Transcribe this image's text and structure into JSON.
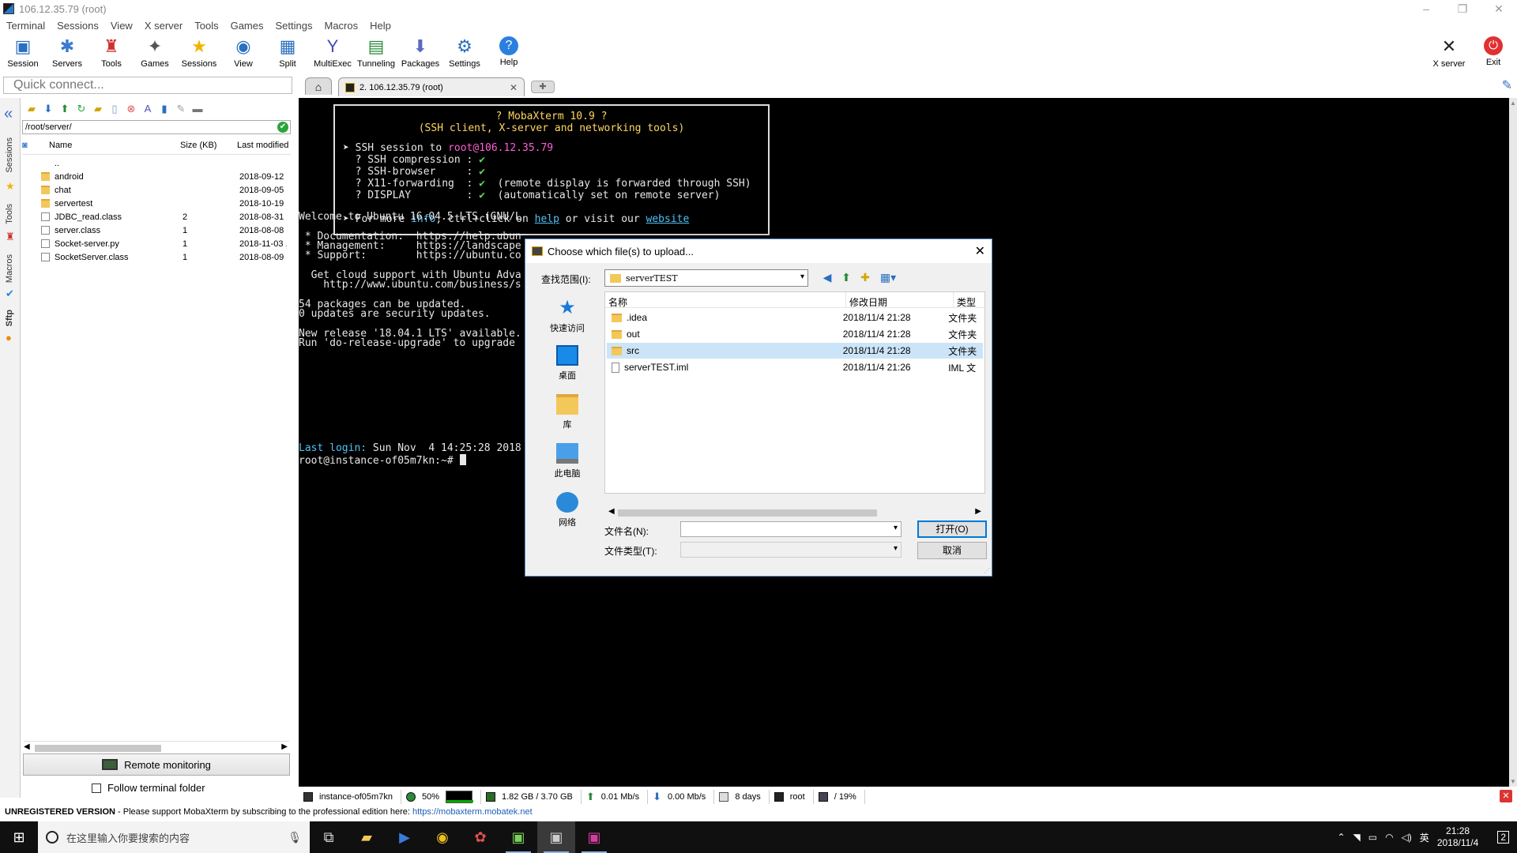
{
  "window": {
    "title": "106.12.35.79 (root)",
    "controls": [
      "–",
      "❐",
      "✕"
    ]
  },
  "menu": [
    "Terminal",
    "Sessions",
    "View",
    "X server",
    "Tools",
    "Games",
    "Settings",
    "Macros",
    "Help"
  ],
  "toolbar": {
    "session": "Session",
    "servers": "Servers",
    "tools": "Tools",
    "games": "Games",
    "sessions": "Sessions",
    "view": "View",
    "split": "Split",
    "multiexec": "MultiExec",
    "tunneling": "Tunneling",
    "packages": "Packages",
    "settings": "Settings",
    "help": "Help",
    "xserver": "X server",
    "exit": "Exit"
  },
  "quick_connect": {
    "placeholder": "Quick connect..."
  },
  "tabs": {
    "session_tab": "2. 106.12.35.79 (root)"
  },
  "vtabs": {
    "sessions": "Sessions",
    "tools": "Tools",
    "macros": "Macros",
    "sftp": "Sftp"
  },
  "sftp": {
    "path": "/root/server/",
    "columns": {
      "name": "Name",
      "size": "Size (KB)",
      "modified": "Last modified"
    },
    "files": [
      {
        "name": "..",
        "size": "",
        "date": "",
        "kind": "up"
      },
      {
        "name": "android",
        "size": "",
        "date": "2018-09-12 ...",
        "kind": "folder"
      },
      {
        "name": "chat",
        "size": "",
        "date": "2018-09-05 ...",
        "kind": "folder"
      },
      {
        "name": "servertest",
        "size": "",
        "date": "2018-10-19 ...",
        "kind": "folder"
      },
      {
        "name": "JDBC_read.class",
        "size": "2",
        "date": "2018-08-31 ...",
        "kind": "file"
      },
      {
        "name": "server.class",
        "size": "1",
        "date": "2018-08-08 ...",
        "kind": "file"
      },
      {
        "name": "Socket-server.py",
        "size": "1",
        "date": "2018-11-03 ...",
        "kind": "file"
      },
      {
        "name": "SocketServer.class",
        "size": "1",
        "date": "2018-08-09 ...",
        "kind": "file"
      }
    ],
    "remote_monitoring": "Remote monitoring",
    "follow_terminal": "Follow terminal folder"
  },
  "terminal": {
    "banner_title": "? MobaXterm 10.9 ?",
    "banner_subtitle": "(SSH client, X-server and networking tools)",
    "ssh_prefix": "➤ SSH session to ",
    "ssh_user": "root",
    "ssh_host": "@106.12.35.79",
    "opt1": "  ? SSH compression : ",
    "opt2": "  ? SSH-browser     : ",
    "opt3": "  ? X11-forwarding  : ",
    "opt3_note": "  (remote display is forwarded through SSH)",
    "opt4": "  ? DISPLAY         : ",
    "opt4_note": "  (automatically set on remote server)",
    "check": "✔",
    "more_a": "➤ For more ",
    "more_info": "info",
    "more_b": ", ctrl+click on ",
    "more_help": "help",
    "more_c": " or visit our ",
    "more_web": "website",
    "lines": [
      "Welcome to Ubuntu 16.04.5 LTS (GNU/L",
      "",
      " * Documentation:  https://help.ubun",
      " * Management:     https://landscape",
      " * Support:        https://ubuntu.co",
      "",
      "  Get cloud support with Ubuntu Adva",
      "    http://www.ubuntu.com/business/s",
      "",
      "54 packages can be updated.",
      "0 updates are security updates.",
      "",
      "New release '18.04.1 LTS' available.",
      "Run 'do-release-upgrade' to upgrade"
    ],
    "last_login_label": "Last login:",
    "last_login_value": " Sun Nov  4 14:25:28 2018",
    "prompt": "root@instance-of05m7kn:~# "
  },
  "statusbar": {
    "host": "instance-of05m7kn",
    "cpu": "50%",
    "mem": "1.82 GB / 3.70 GB",
    "up": "0.01 Mb/s",
    "down": "0.00 Mb/s",
    "uptime": "8 days",
    "user": "root",
    "disk": "/  19%"
  },
  "unregistered": {
    "bold": "UNREGISTERED VERSION",
    "text": "  -  Please support MobaXterm by subscribing to the professional edition here:  ",
    "link": "https://mobaxterm.mobatek.net"
  },
  "dialog": {
    "title": "Choose which file(s) to upload...",
    "look_in_label": "查找范围(I):",
    "look_in_value": "serverTEST",
    "places": [
      "快速访问",
      "桌面",
      "库",
      "此电脑",
      "网络"
    ],
    "columns": {
      "name": "名称",
      "date": "修改日期",
      "type": "类型"
    },
    "files": [
      {
        "name": ".idea",
        "date": "2018/11/4 21:28",
        "type": "文件夹",
        "kind": "folder"
      },
      {
        "name": "out",
        "date": "2018/11/4 21:28",
        "type": "文件夹",
        "kind": "folder"
      },
      {
        "name": "src",
        "date": "2018/11/4 21:28",
        "type": "文件夹",
        "kind": "folder"
      },
      {
        "name": "serverTEST.iml",
        "date": "2018/11/4 21:26",
        "type": "IML 文",
        "kind": "file"
      }
    ],
    "selected_row": 2,
    "filename_label": "文件名(N):",
    "filetype_label": "文件类型(T):",
    "open_button": "打开(O)",
    "cancel_button": "取消"
  },
  "taskbar": {
    "search_placeholder": "在这里输入你要搜索的内容",
    "time": "21:28",
    "date": "2018/11/4",
    "ime": "英",
    "notif_count": "2"
  },
  "colors": {
    "terminal_bg": "#000000",
    "accent": "#0078d7",
    "taskbar_bg": "#101010"
  }
}
